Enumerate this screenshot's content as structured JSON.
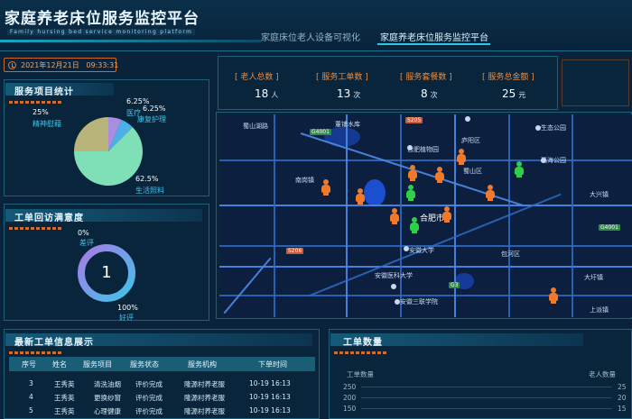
{
  "header": {
    "title": "家庭养老床位服务监控平台",
    "subtitle": "Family hursing bed service monitoring platform",
    "nav": [
      {
        "label": "家庭床位老人设备可视化",
        "active": false
      },
      {
        "label": "家庭养老床位服务监控平台",
        "active": true
      }
    ]
  },
  "datetime": {
    "date": "2021年12月21日",
    "time": "09:33:31"
  },
  "stats": [
    {
      "label": "[ 老人总数 ]",
      "value": "18",
      "unit": "人"
    },
    {
      "label": "[ 服务工单数 ]",
      "value": "13",
      "unit": "次"
    },
    {
      "label": "[ 服务套餐数 ]",
      "value": "8",
      "unit": "次"
    },
    {
      "label": "[ 服务总金额 ]",
      "value": "25",
      "unit": "元"
    }
  ],
  "service_stats": {
    "title": "服务项目统计",
    "slices": [
      {
        "label": "生活照料",
        "percent": "62.5%",
        "value": 62.5,
        "color": "#7fe0b8"
      },
      {
        "label": "精神慰藉",
        "percent": "25%",
        "value": 25,
        "color": "#b8b47a"
      },
      {
        "label": "医疗",
        "percent": "6.25%",
        "value": 6.25,
        "color": "#a98ee0"
      },
      {
        "label": "康复护理",
        "percent": "6.25%",
        "value": 6.25,
        "color": "#4ab0e6"
      }
    ]
  },
  "satisfaction": {
    "title": "工单回访满意度",
    "center_value": "1",
    "bad_percent": "0%",
    "bad_label": "差评",
    "good_percent": "100%",
    "good_label": "好评"
  },
  "map": {
    "labels": [
      "蜀山湖路",
      "董铺水库",
      "合肥植物园",
      "庐阳区",
      "生态公园",
      "瑶海公园",
      "蜀山区",
      "南岗镇",
      "大兴镇",
      "合肥市",
      "安徽大学",
      "包河区",
      "安徽医科大学",
      "大圩镇",
      "安徽三联学院",
      "上派镇"
    ],
    "shields": [
      {
        "text": "G4001",
        "color": "#2f8a4a"
      },
      {
        "text": "S205",
        "color": "#c85a3a"
      },
      {
        "text": "S206",
        "color": "#c85a3a"
      },
      {
        "text": "G4001",
        "color": "#2f8a4a"
      },
      {
        "text": "G3",
        "color": "#2f8a4a"
      }
    ]
  },
  "work_orders": {
    "title": "最新工单信息展示",
    "columns": [
      "序号",
      "姓名",
      "服务项目",
      "服务状态",
      "服务机构",
      "下单时间"
    ],
    "rows": [
      [
        "3",
        "王秀英",
        "清洗油烟",
        "评价完成",
        "隆源村养老服",
        "10-19 16:13"
      ],
      [
        "4",
        "王秀英",
        "更换纱窗",
        "评价完成",
        "隆源村养老服",
        "10-19 16:13"
      ],
      [
        "5",
        "王秀英",
        "心理健康",
        "评价完成",
        "隆源村养老服",
        "10-19 16:13"
      ]
    ]
  },
  "order_count": {
    "title": "工单数量",
    "left_axis_label": "工单数量",
    "right_axis_label": "老人数量",
    "left_ticks": [
      "250",
      "200",
      "150"
    ],
    "right_ticks": [
      "25",
      "20",
      "15"
    ]
  }
}
